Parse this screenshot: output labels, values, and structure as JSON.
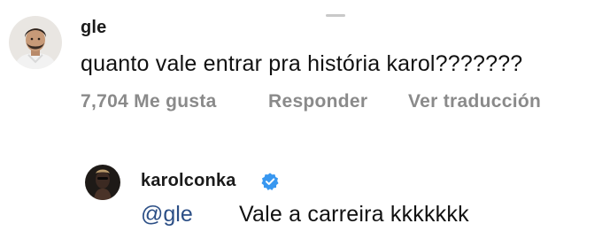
{
  "comments": [
    {
      "username": "gle",
      "text": "quanto vale entrar pra história karol???????",
      "likes": "7,704 Me gusta",
      "reply_label": "Responder",
      "translate_label": "Ver traducción",
      "avatar_icon": "user-avatar-man"
    },
    {
      "username": "karolconka",
      "verified": true,
      "verified_icon": "verified-badge-icon",
      "mention": "@gle",
      "text": "Vale a carreira kkkkkkk",
      "avatar_icon": "user-avatar-woman"
    }
  ],
  "colors": {
    "text": "#111111",
    "meta": "#8a8a8a",
    "mention": "#2c4f86",
    "verified": "#3897f0"
  }
}
